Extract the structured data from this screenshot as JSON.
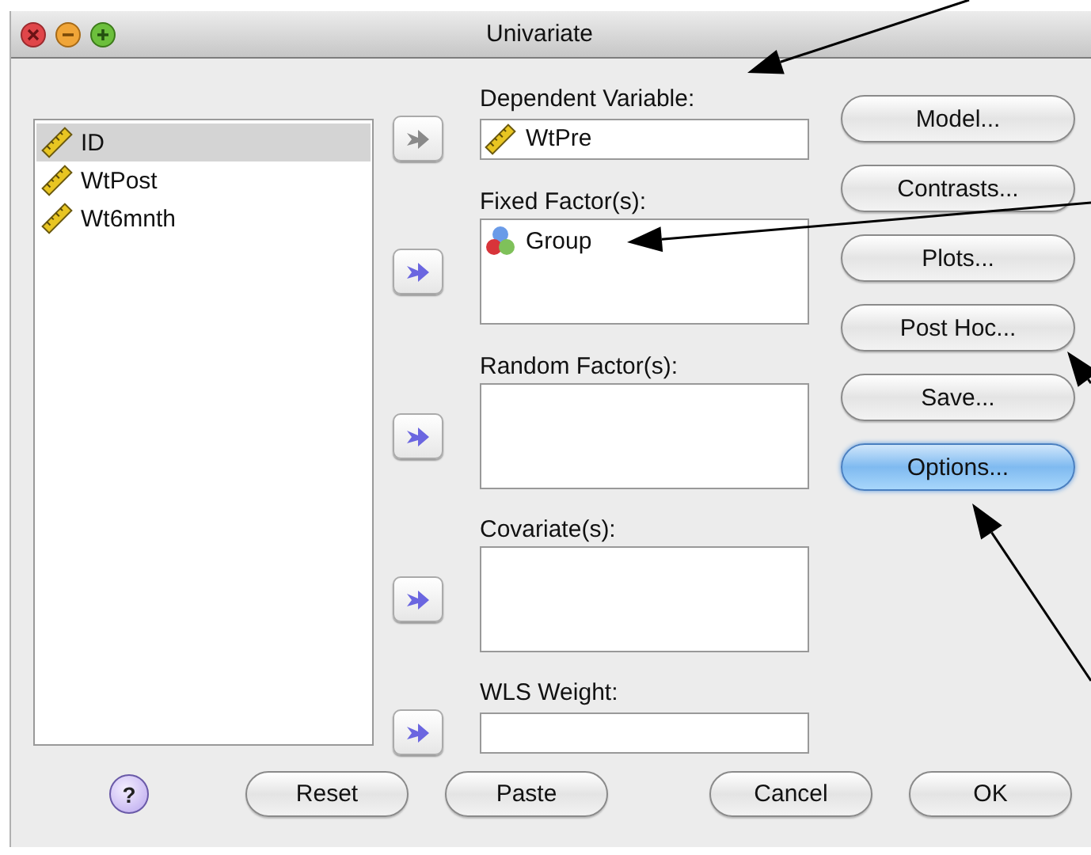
{
  "window": {
    "title": "Univariate"
  },
  "source_variables": [
    {
      "name": "ID",
      "selected": true
    },
    {
      "name": "WtPost",
      "selected": false
    },
    {
      "name": "Wt6mnth",
      "selected": false
    }
  ],
  "target_boxes": [
    {
      "kind": "field",
      "label": "Dependent Variable:",
      "disabled": true,
      "items": [
        {
          "name": "WtPre",
          "kind": "scale"
        }
      ]
    },
    {
      "kind": "list",
      "label": "Fixed Factor(s):",
      "disabled": false,
      "items": [
        {
          "name": "Group",
          "kind": "nominal"
        }
      ]
    },
    {
      "kind": "list",
      "label": "Random Factor(s):",
      "disabled": false
    },
    {
      "kind": "list",
      "label": "Covariate(s):",
      "disabled": false
    },
    {
      "kind": "field",
      "label": "WLS Weight:",
      "disabled": false
    }
  ],
  "side_buttons": [
    {
      "label": "Model...",
      "default": false
    },
    {
      "label": "Contrasts...",
      "default": false
    },
    {
      "label": "Plots...",
      "default": false
    },
    {
      "label": "Post Hoc...",
      "default": false
    },
    {
      "label": "Save...",
      "default": false
    },
    {
      "label": "Options...",
      "default": true
    }
  ],
  "help_button": "?",
  "bottom_buttons": [
    "Reset",
    "Paste",
    "Cancel",
    "OK"
  ]
}
